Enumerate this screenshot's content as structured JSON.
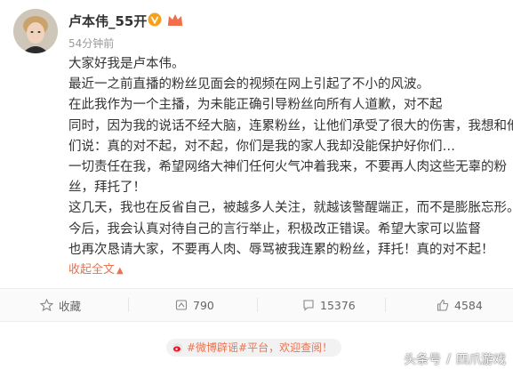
{
  "post": {
    "author": "卢本伟_55开",
    "time": "54分钟前",
    "lines": [
      "大家好我是卢本伟。",
      "最近一之前直播的粉丝见面会的视频在网上引起了不小的风波。",
      "在此我作为一个主播，为未能正确引导粉丝向所有人道歉，对不起",
      "同时，因为我的说话不经大脑，连累粉丝，让他们承受了很大的伤害，我想和他",
      "们说：真的对不起，对不起，你们是我的家人我却没能保护好你们…",
      "一切责任在我，希望网络大神们任何火气冲着我来，不要再人肉这些无辜的粉",
      "丝，拜托了！",
      "这几天，我也在反省自己，被越多人关注，就越该警醒端正，而不是膨胀忘形。",
      "今后，我会认真对待自己的言行举止，积极改正错误。希望大家可以监督",
      "也再次恳请大家，不要再人肉、辱骂被我连累的粉丝，拜托！真的对不起！"
    ],
    "collapse_label": "收起全文"
  },
  "actions": {
    "favorite": "收藏",
    "repost": "790",
    "comment": "15376",
    "like": "4584"
  },
  "topic": {
    "tag": "#微博辟谣#平台，",
    "link": "欢迎查阅！"
  },
  "watermark": {
    "left": "头条号",
    "right": "四爪游戏"
  },
  "colors": {
    "accent": "#eb7350",
    "text": "#333333",
    "muted": "#999999"
  }
}
